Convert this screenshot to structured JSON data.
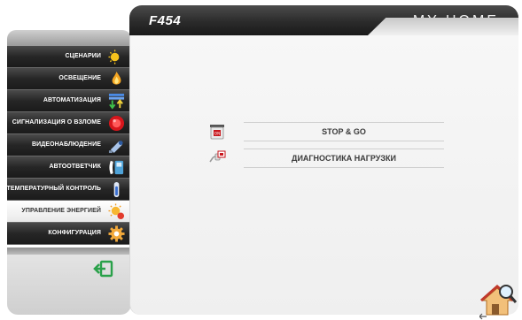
{
  "header": {
    "model": "F454",
    "brand": "MY HOME"
  },
  "sidebar": {
    "items": [
      {
        "label": "СЦЕНАРИИ",
        "icon": "scenarios-sun-moon-icon",
        "active": false
      },
      {
        "label": "ОСВЕЩЕНИЕ",
        "icon": "lighting-flame-icon",
        "active": false
      },
      {
        "label": "АВТОМАТИЗАЦИЯ",
        "icon": "automation-arrows-icon",
        "active": false
      },
      {
        "label": "СИГНАЛИЗАЦИЯ О ВЗЛОМЕ",
        "icon": "alarm-red-button-icon",
        "active": false
      },
      {
        "label": "ВИДЕОНАБЛЮДЕНИЕ",
        "icon": "camera-icon",
        "active": false
      },
      {
        "label": "АВТООТВЕТЧИК",
        "icon": "answering-phone-icon",
        "active": false
      },
      {
        "label": "ТЕМПЕРАТУРНЫЙ КОНТРОЛЬ",
        "icon": "thermometer-icon",
        "active": false
      },
      {
        "label": "УПРАВЛЕНИЕ ЭНЕРГИЕЙ",
        "icon": "energy-sun-icon",
        "active": true
      },
      {
        "label": "КОНФИГУРАЦИЯ",
        "icon": "gear-icon",
        "active": false
      }
    ],
    "exit_icon": "exit-arrow-icon"
  },
  "menu": {
    "items": [
      {
        "label": "STOP & GO",
        "icon": "stop-and-go-device-icon"
      },
      {
        "label": "ДИАГНОСТИКА НАГРУЗКИ",
        "icon": "load-diagnostics-plug-icon"
      }
    ]
  },
  "home_icon": "home-search-icon",
  "colors": {
    "sidebar_item": "#262626",
    "sidebar_active": "#ffffff",
    "header": "#2b2b2b",
    "content_bg": "#f3f3f3",
    "accent_green": "#2aa14a"
  }
}
